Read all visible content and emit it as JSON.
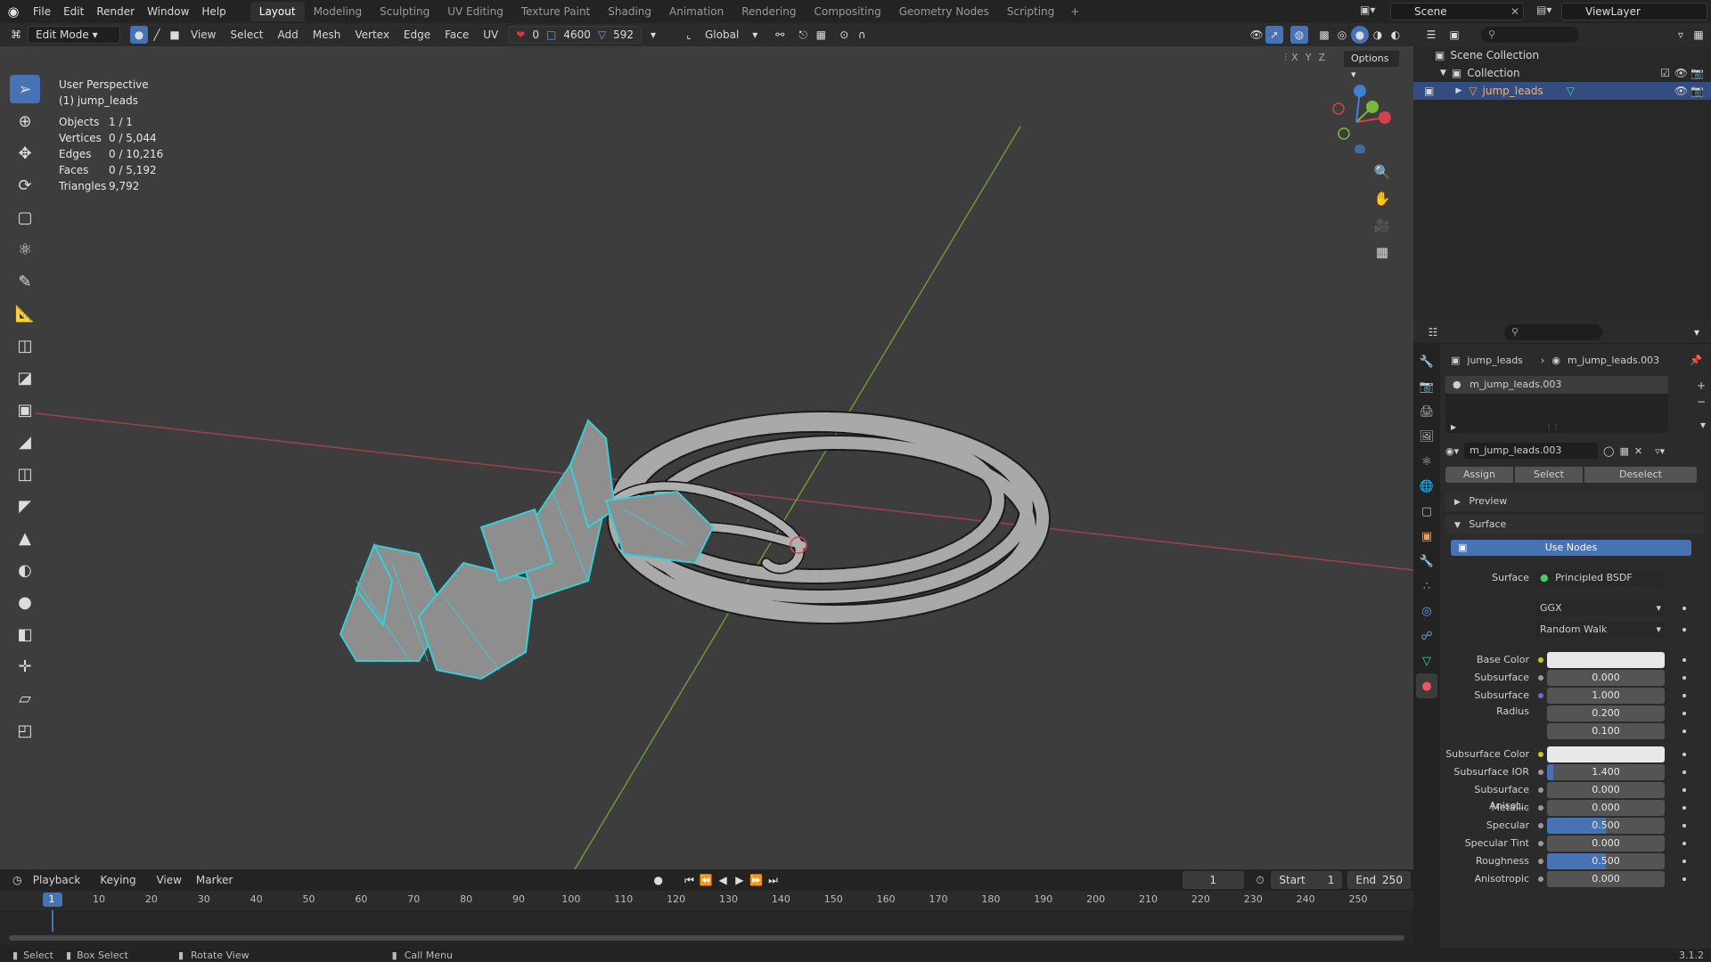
{
  "topbar": {
    "menus": [
      "File",
      "Edit",
      "Render",
      "Window",
      "Help"
    ],
    "workspaces": [
      "Layout",
      "Modeling",
      "Sculpting",
      "UV Editing",
      "Texture Paint",
      "Shading",
      "Animation",
      "Rendering",
      "Compositing",
      "Geometry Nodes",
      "Scripting"
    ],
    "active_workspace": "Layout",
    "scene": "Scene",
    "view_layer": "ViewLayer"
  },
  "viewport_header": {
    "mode": "Edit Mode",
    "menus": [
      "View",
      "Select",
      "Add",
      "Mesh",
      "Vertex",
      "Edge",
      "Face",
      "UV"
    ],
    "counters": [
      "0",
      "4600",
      "592"
    ],
    "orientation": "Global",
    "options": "Options",
    "axes": [
      "X",
      "Y",
      "Z"
    ]
  },
  "overlay": {
    "view_name": "User Perspective",
    "object_name": "(1) jump_leads",
    "stats": [
      {
        "k": "Objects",
        "v": "1 / 1"
      },
      {
        "k": "Vertices",
        "v": "0 / 5,044"
      },
      {
        "k": "Edges",
        "v": "0 / 10,216"
      },
      {
        "k": "Faces",
        "v": "0 / 5,192"
      },
      {
        "k": "Triangles",
        "v": "9,792"
      }
    ]
  },
  "timeline": {
    "menus": [
      "Playback",
      "Keying",
      "View",
      "Marker"
    ],
    "current_frame": "1",
    "start_label": "Start",
    "start": "1",
    "end_label": "End",
    "end": "250",
    "ticks": [
      "1",
      "10",
      "20",
      "30",
      "40",
      "50",
      "60",
      "70",
      "80",
      "90",
      "100",
      "110",
      "120",
      "130",
      "140",
      "150",
      "160",
      "170",
      "180",
      "190",
      "200",
      "210",
      "220",
      "230",
      "240",
      "250"
    ]
  },
  "statusbar": {
    "select": "Select",
    "box_select": "Box Select",
    "rotate_view": "Rotate View",
    "call_menu": "Call Menu",
    "version": "3.1.2"
  },
  "outliner": {
    "scene_collection": "Scene Collection",
    "collection": "Collection",
    "object": "jump_leads"
  },
  "properties": {
    "breadcrumb_object": "jump_leads",
    "breadcrumb_material": "m_jump_leads.003",
    "slot": "m_jump_leads.003",
    "material_name": "m_jump_leads.003",
    "assign": "Assign",
    "select": "Select",
    "deselect": "Deselect",
    "preview": "Preview",
    "surface_panel": "Surface",
    "use_nodes": "Use Nodes",
    "surface_label": "Surface",
    "surface_value": "Principled BSDF",
    "distribution": "GGX",
    "subsurface_method": "Random Walk",
    "rows": [
      {
        "label": "Base Color",
        "value": "",
        "kind": "color"
      },
      {
        "label": "Subsurface",
        "value": "0.000",
        "kind": "num"
      },
      {
        "label": "Subsurface Radius",
        "value": "1.000",
        "kind": "num"
      },
      {
        "label": "",
        "value": "0.200",
        "kind": "num"
      },
      {
        "label": "",
        "value": "0.100",
        "kind": "num"
      },
      {
        "label": "Subsurface Color",
        "value": "",
        "kind": "color"
      },
      {
        "label": "Subsurface IOR",
        "value": "1.400",
        "kind": "slider",
        "fill": 0.05
      },
      {
        "label": "Subsurface Anisot...",
        "value": "0.000",
        "kind": "num"
      },
      {
        "label": "Metallic",
        "value": "0.000",
        "kind": "num"
      },
      {
        "label": "Specular",
        "value": "0.500",
        "kind": "slider",
        "fill": 0.5
      },
      {
        "label": "Specular Tint",
        "value": "0.000",
        "kind": "num"
      },
      {
        "label": "Roughness",
        "value": "0.500",
        "kind": "slider",
        "fill": 0.5
      },
      {
        "label": "Anisotropic",
        "value": "0.000",
        "kind": "num"
      }
    ]
  },
  "colors": {
    "accent": "#4772b3",
    "x_axis": "#d3424a",
    "y_axis": "#7ab83a",
    "z_axis": "#3f7fd4",
    "selection_cyan": "#34d0d8"
  }
}
